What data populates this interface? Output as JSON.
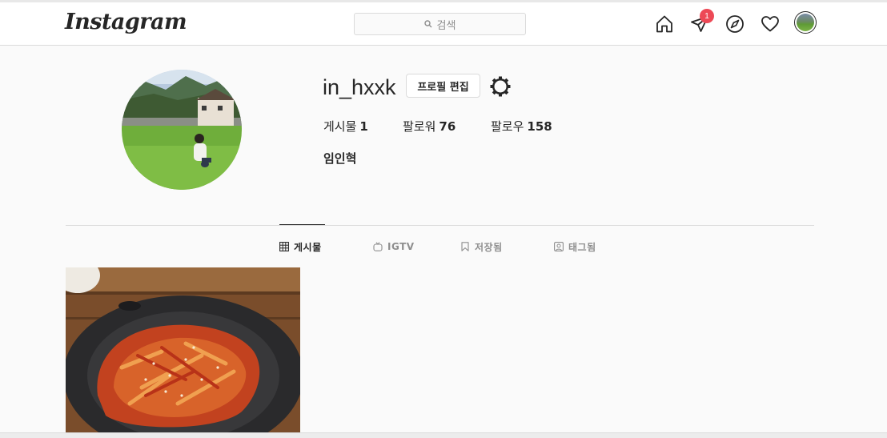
{
  "header": {
    "logo_text": "Instagram",
    "search_placeholder": "검색",
    "notifications_badge": "1"
  },
  "profile": {
    "username": "in_hxxk",
    "edit_button": "프로필 편집",
    "stats": [
      {
        "label": "게시물",
        "value": "1"
      },
      {
        "label": "팔로워",
        "value": "76"
      },
      {
        "label": "팔로우",
        "value": "158"
      }
    ],
    "full_name": "임인혁"
  },
  "tabs": [
    {
      "label": "게시물",
      "icon": "grid-icon",
      "active": true
    },
    {
      "label": "IGTV",
      "icon": "igtv-icon",
      "active": false
    },
    {
      "label": "저장됨",
      "icon": "bookmark-icon",
      "active": false
    },
    {
      "label": "태그됨",
      "icon": "tagged-icon",
      "active": false
    }
  ],
  "colors": {
    "badge": "#ed4956",
    "text": "#262626",
    "muted": "#8e8e8e",
    "border": "#dbdbdb"
  }
}
